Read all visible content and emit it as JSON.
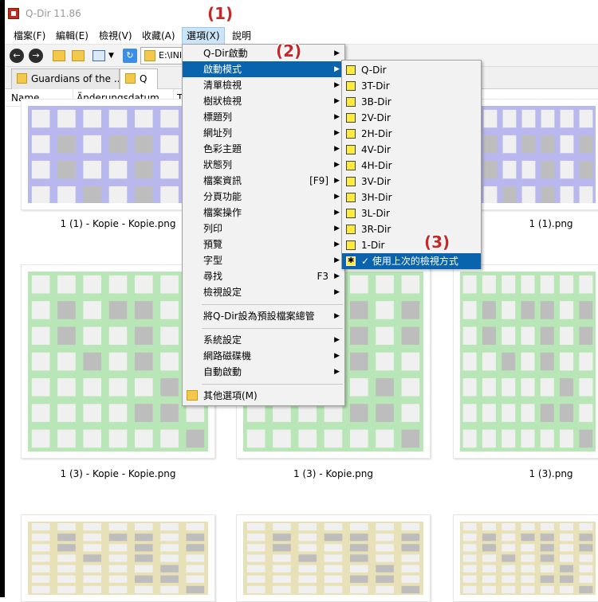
{
  "window": {
    "title": "Q-Dir 11.86"
  },
  "menubar": [
    {
      "label": "檔案(F)",
      "active": false
    },
    {
      "label": "編輯(E)",
      "active": false
    },
    {
      "label": "檢視(V)",
      "active": false
    },
    {
      "label": "收藏(A)",
      "active": false
    },
    {
      "label": "選項(X)",
      "active": true
    },
    {
      "label": "說明",
      "active": false
    }
  ],
  "toolbar": {
    "address": "E:\\INI"
  },
  "tabs": [
    {
      "label": "Guardians of the ...",
      "active": false
    },
    {
      "label": "Q",
      "active": true
    }
  ],
  "columns": [
    "Name",
    "Änderungsdatum",
    "T"
  ],
  "files": [
    {
      "caption": "1 (1) - Kopie - Kopie.png",
      "color": "#b8b8ee"
    },
    {
      "caption": "1 (1).png",
      "color": "#b8b8ee"
    },
    {
      "caption": "1 (3) - Kopie - Kopie.png",
      "color": "#b9e6b6"
    },
    {
      "caption": "1 (3) - Kopie.png",
      "color": "#b9e6b6"
    },
    {
      "caption": "1 (3).png",
      "color": "#b9e6b6"
    },
    {
      "caption": "",
      "color": "#e8e0b6"
    },
    {
      "caption": "",
      "color": "#e8e0b6"
    },
    {
      "caption": "",
      "color": "#e8e0b6"
    }
  ],
  "options_menu": {
    "items": [
      {
        "label": "Q-Dir啟動",
        "arrow": true
      },
      {
        "label": "啟動模式",
        "arrow": true,
        "highlighted": true
      },
      {
        "label": "清單檢視",
        "arrow": true
      },
      {
        "label": "樹狀檢視",
        "arrow": true
      },
      {
        "label": "標題列",
        "arrow": true
      },
      {
        "label": "網址列",
        "arrow": true
      },
      {
        "label": "色彩主題",
        "arrow": true
      },
      {
        "label": "狀態列",
        "arrow": true
      },
      {
        "label": "檔案資訊",
        "shortcut": "[F9]",
        "arrow": true
      },
      {
        "label": "分頁功能",
        "arrow": true
      },
      {
        "label": "檔案操作",
        "arrow": true
      },
      {
        "label": "列印",
        "arrow": true
      },
      {
        "label": "預覽",
        "arrow": true
      },
      {
        "label": "字型",
        "arrow": true
      },
      {
        "label": "尋找",
        "shortcut": "F3",
        "arrow": true
      },
      {
        "label": "檢視設定",
        "arrow": true
      },
      {
        "label": "將Q-Dir設為預設檔案總管",
        "arrow": true
      },
      {
        "label": "系統設定",
        "arrow": true
      },
      {
        "label": "網路磁碟機",
        "arrow": true
      },
      {
        "label": "自動啟動",
        "arrow": true
      },
      {
        "label": "其他選項(M)",
        "arrow": false
      }
    ]
  },
  "startup_submenu": {
    "items": [
      {
        "label": "Q-Dir",
        "icon": "layout-quad-icon"
      },
      {
        "label": "3T-Dir",
        "icon": "layout-3t-icon"
      },
      {
        "label": "3B-Dir",
        "icon": "layout-3b-icon"
      },
      {
        "label": "2V-Dir",
        "icon": "layout-2v-icon"
      },
      {
        "label": "2H-Dir",
        "icon": "layout-2h-icon"
      },
      {
        "label": "4V-Dir",
        "icon": "layout-4v-icon"
      },
      {
        "label": "4H-Dir",
        "icon": "layout-4h-icon"
      },
      {
        "label": "3V-Dir",
        "icon": "layout-3v-icon"
      },
      {
        "label": "3H-Dir",
        "icon": "layout-3h-icon"
      },
      {
        "label": "3L-Dir",
        "icon": "layout-3l-icon"
      },
      {
        "label": "3R-Dir",
        "icon": "layout-3r-icon"
      },
      {
        "label": "1-Dir",
        "icon": "layout-1-icon"
      },
      {
        "label": "使用上次的檢視方式",
        "icon": "last-view-icon",
        "checked": true,
        "check_mark": "✓",
        "highlighted": true
      }
    ]
  },
  "annotations": [
    "(1)",
    "(2)",
    "(3)"
  ],
  "colors": {
    "menu_highlight": "#0a64ad",
    "annotation": "#c62828",
    "menubar_active": "#cce4f7"
  }
}
